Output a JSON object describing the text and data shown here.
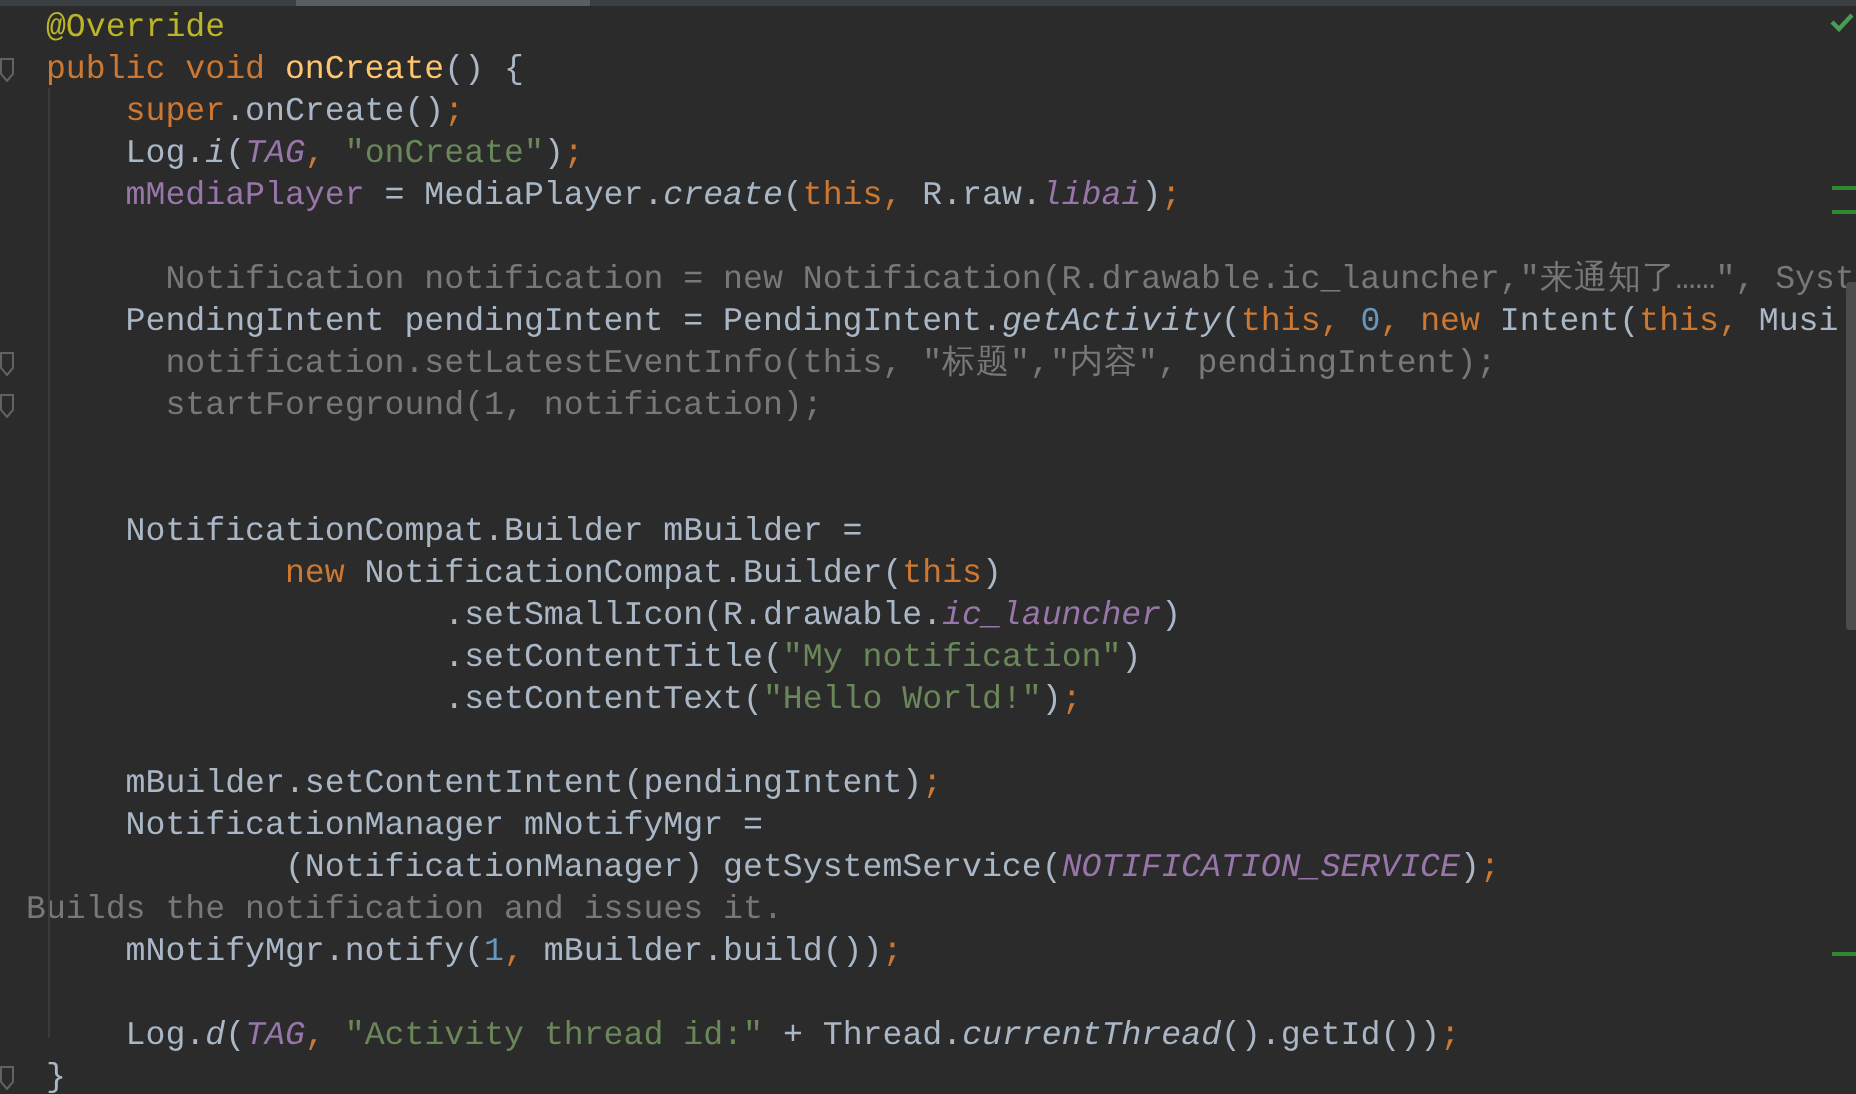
{
  "editor": {
    "lines": [
      {
        "fold_marker": false,
        "tokens": [
          {
            "text": " @Override",
            "kind": "annotation"
          }
        ]
      },
      {
        "fold_marker": true,
        "tokens": [
          {
            "text": " public void ",
            "kind": "keyword"
          },
          {
            "text": "onCreate",
            "kind": "method"
          },
          {
            "text": "() {",
            "kind": "plain"
          }
        ]
      },
      {
        "fold_marker": false,
        "tokens": [
          {
            "text": "     super",
            "kind": "keyword"
          },
          {
            "text": ".onCreate()",
            "kind": "plain"
          },
          {
            "text": ";",
            "kind": "keyword"
          }
        ]
      },
      {
        "fold_marker": false,
        "tokens": [
          {
            "text": "     Log.",
            "kind": "plain"
          },
          {
            "text": "i",
            "kind": "static"
          },
          {
            "text": "(",
            "kind": "plain"
          },
          {
            "text": "TAG",
            "kind": "constant"
          },
          {
            "text": ", ",
            "kind": "keyword"
          },
          {
            "text": "\"onCreate\"",
            "kind": "string"
          },
          {
            "text": ")",
            "kind": "plain"
          },
          {
            "text": ";",
            "kind": "keyword"
          }
        ]
      },
      {
        "fold_marker": false,
        "tokens": [
          {
            "text": "     mMediaPlayer",
            "kind": "field"
          },
          {
            "text": " = MediaPlayer.",
            "kind": "plain"
          },
          {
            "text": "create",
            "kind": "static"
          },
          {
            "text": "(",
            "kind": "plain"
          },
          {
            "text": "this, ",
            "kind": "keyword"
          },
          {
            "text": "R.raw.",
            "kind": "plain"
          },
          {
            "text": "libai",
            "kind": "constant"
          },
          {
            "text": ")",
            "kind": "plain"
          },
          {
            "text": ";",
            "kind": "keyword"
          }
        ]
      },
      {
        "fold_marker": false
      },
      {
        "fold_marker": false,
        "tokens": [
          {
            "text": "       Notification notification = new Notification(R.drawable.ic_launcher,\"来通知了……\", Syst",
            "kind": "dim"
          }
        ]
      },
      {
        "fold_marker": false,
        "tokens": [
          {
            "text": "     PendingIntent pendingIntent = PendingIntent.",
            "kind": "plain"
          },
          {
            "text": "getActivity",
            "kind": "static"
          },
          {
            "text": "(",
            "kind": "plain"
          },
          {
            "text": "this, ",
            "kind": "keyword"
          },
          {
            "text": "0",
            "kind": "number"
          },
          {
            "text": ", new ",
            "kind": "keyword"
          },
          {
            "text": "Intent(",
            "kind": "plain"
          },
          {
            "text": "this, ",
            "kind": "keyword"
          },
          {
            "text": "Musi",
            "kind": "plain"
          }
        ]
      },
      {
        "fold_marker": true,
        "tokens": [
          {
            "text": "       notification.setLatestEventInfo(this, \"标题\",\"内容\", pendingIntent);",
            "kind": "dim"
          }
        ]
      },
      {
        "fold_marker": true,
        "tokens": [
          {
            "text": "       startForeground(1, notification);",
            "kind": "dim"
          }
        ]
      },
      {
        "fold_marker": false
      },
      {
        "fold_marker": false
      },
      {
        "fold_marker": false,
        "tokens": [
          {
            "text": "     NotificationCompat.Builder mBuilder =",
            "kind": "plain"
          }
        ]
      },
      {
        "fold_marker": false,
        "tokens": [
          {
            "text": "             new ",
            "kind": "keyword"
          },
          {
            "text": "NotificationCompat.Builder(",
            "kind": "plain"
          },
          {
            "text": "this",
            "kind": "keyword"
          },
          {
            "text": ")",
            "kind": "plain"
          }
        ]
      },
      {
        "fold_marker": false,
        "tokens": [
          {
            "text": "                     .setSmallIcon(R.drawable.",
            "kind": "plain"
          },
          {
            "text": "ic_launcher",
            "kind": "constant"
          },
          {
            "text": ")",
            "kind": "plain"
          }
        ]
      },
      {
        "fold_marker": false,
        "tokens": [
          {
            "text": "                     .setContentTitle(",
            "kind": "plain"
          },
          {
            "text": "\"My notification\"",
            "kind": "string"
          },
          {
            "text": ")",
            "kind": "plain"
          }
        ]
      },
      {
        "fold_marker": false,
        "tokens": [
          {
            "text": "                     .setContentText(",
            "kind": "plain"
          },
          {
            "text": "\"Hello World!\"",
            "kind": "string"
          },
          {
            "text": ")",
            "kind": "plain"
          },
          {
            "text": ";",
            "kind": "keyword"
          }
        ]
      },
      {
        "fold_marker": false
      },
      {
        "fold_marker": false,
        "tokens": [
          {
            "text": "     mBuilder.setContentIntent(pendingIntent)",
            "kind": "plain"
          },
          {
            "text": ";",
            "kind": "keyword"
          }
        ]
      },
      {
        "fold_marker": false,
        "tokens": [
          {
            "text": "     NotificationManager mNotifyMgr =",
            "kind": "plain"
          }
        ]
      },
      {
        "fold_marker": false,
        "tokens": [
          {
            "text": "             (NotificationManager) getSystemService(",
            "kind": "plain"
          },
          {
            "text": "NOTIFICATION_SERVICE",
            "kind": "constant"
          },
          {
            "text": ")",
            "kind": "plain"
          },
          {
            "text": ";",
            "kind": "keyword"
          }
        ]
      },
      {
        "fold_marker": false,
        "tokens": [
          {
            "text": "Builds the notification and issues it.",
            "kind": "dim"
          }
        ]
      },
      {
        "fold_marker": false,
        "tokens": [
          {
            "text": "     mNotifyMgr.notify(",
            "kind": "plain"
          },
          {
            "text": "1",
            "kind": "number"
          },
          {
            "text": ", ",
            "kind": "keyword"
          },
          {
            "text": "mBuilder.build())",
            "kind": "plain"
          },
          {
            "text": ";",
            "kind": "keyword"
          }
        ]
      },
      {
        "fold_marker": false
      },
      {
        "fold_marker": false,
        "tokens": [
          {
            "text": "     Log.",
            "kind": "plain"
          },
          {
            "text": "d",
            "kind": "static"
          },
          {
            "text": "(",
            "kind": "plain"
          },
          {
            "text": "TAG",
            "kind": "constant"
          },
          {
            "text": ", ",
            "kind": "keyword"
          },
          {
            "text": "\"Activity thread id:\"",
            "kind": "string"
          },
          {
            "text": " + Thread.",
            "kind": "plain"
          },
          {
            "text": "currentThread",
            "kind": "static"
          },
          {
            "text": "().getId())",
            "kind": "plain"
          },
          {
            "text": ";",
            "kind": "keyword"
          }
        ]
      },
      {
        "fold_marker": true,
        "tokens": [
          {
            "text": " }",
            "kind": "plain"
          }
        ]
      }
    ]
  }
}
